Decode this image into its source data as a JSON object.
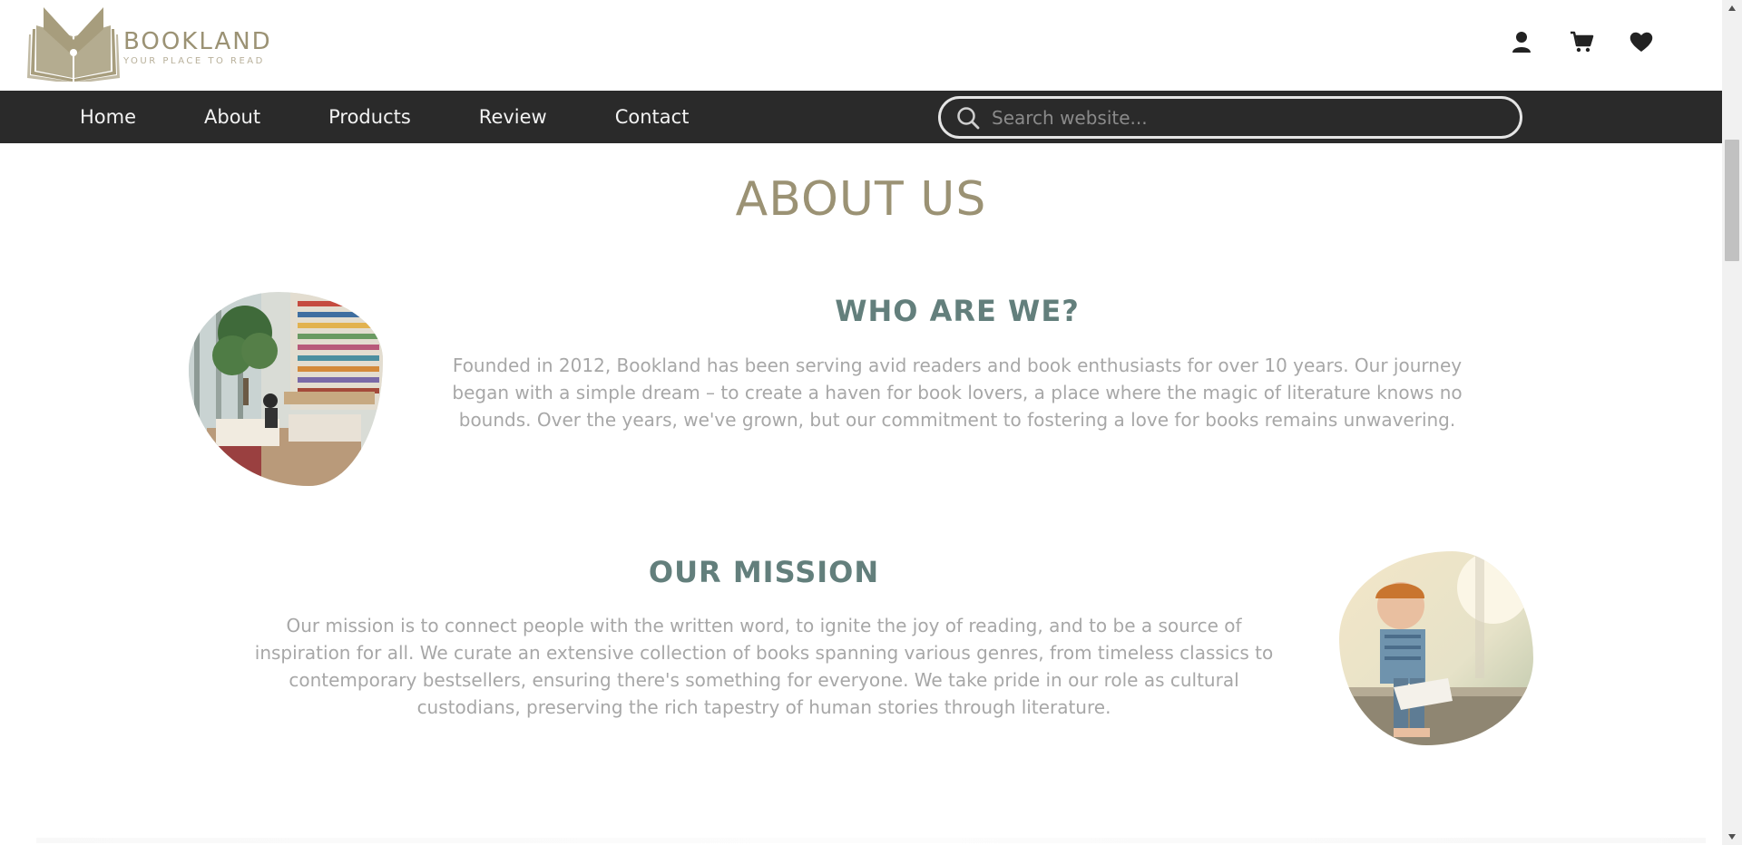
{
  "brand": {
    "name": "BOOKLAND",
    "tagline": "YOUR PLACE TO READ",
    "color": "#9b9274"
  },
  "header": {
    "icons": [
      "user-icon",
      "cart-icon",
      "heart-icon"
    ]
  },
  "nav": {
    "links": [
      "Home",
      "About",
      "Products",
      "Review",
      "Contact"
    ],
    "search_placeholder": "Search website..."
  },
  "about": {
    "title": "ABOUT US",
    "who": {
      "heading": "WHO ARE WE?",
      "body": "Founded in 2012, Bookland has been serving avid readers and book enthusiasts for over 10 years. Our journey began with a simple dream – to create a haven for book lovers, a place where the magic of literature knows no bounds. Over the years, we've grown, but our commitment to fostering a love for books remains unwavering."
    },
    "mission": {
      "heading": "OUR MISSION",
      "body": "Our mission is to connect people with the written word, to ignite the joy of reading, and to be a source of inspiration for all. We curate an extensive collection of books spanning various genres, from timeless classics to contemporary bestsellers, ensuring there's something for everyone. We take pride in our role as cultural custodians, preserving the rich tapestry of human stories through literature."
    }
  },
  "colors": {
    "nav_bg": "#2a2a2a",
    "heading_teal": "#637f7c",
    "body_gray": "#a7a7a7"
  }
}
